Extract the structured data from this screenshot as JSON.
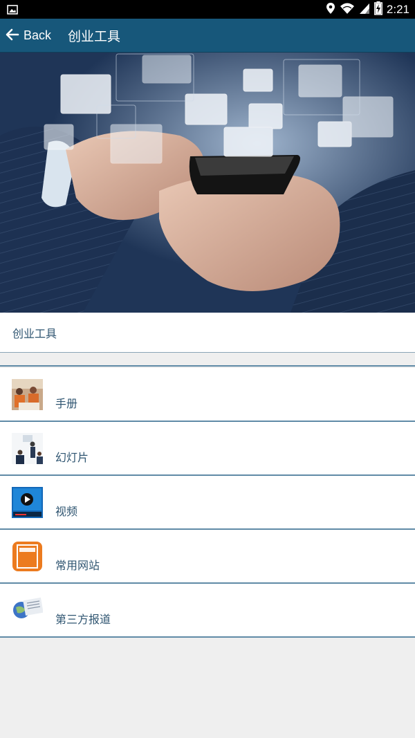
{
  "status_bar": {
    "time": "2:21",
    "icons": [
      "image-notification-icon",
      "location-icon",
      "wifi-icon",
      "cell-signal-icon",
      "battery-charging-icon"
    ]
  },
  "app_bar": {
    "back_label": "Back",
    "title": "创业工具"
  },
  "section": {
    "title": "创业工具"
  },
  "items": [
    {
      "label": "手册",
      "icon": "manual-photo-thumbnail"
    },
    {
      "label": "幻灯片",
      "icon": "slides-photo-thumbnail"
    },
    {
      "label": "视频",
      "icon": "video-player-thumbnail"
    },
    {
      "label": "常用网站",
      "icon": "website-book-thumbnail"
    },
    {
      "label": "第三方报道",
      "icon": "news-globe-thumbnail"
    }
  ],
  "colors": {
    "app_bar": "#17577a",
    "text": "#2e5470",
    "divider": "#5f8aa6",
    "background": "#efefef"
  }
}
